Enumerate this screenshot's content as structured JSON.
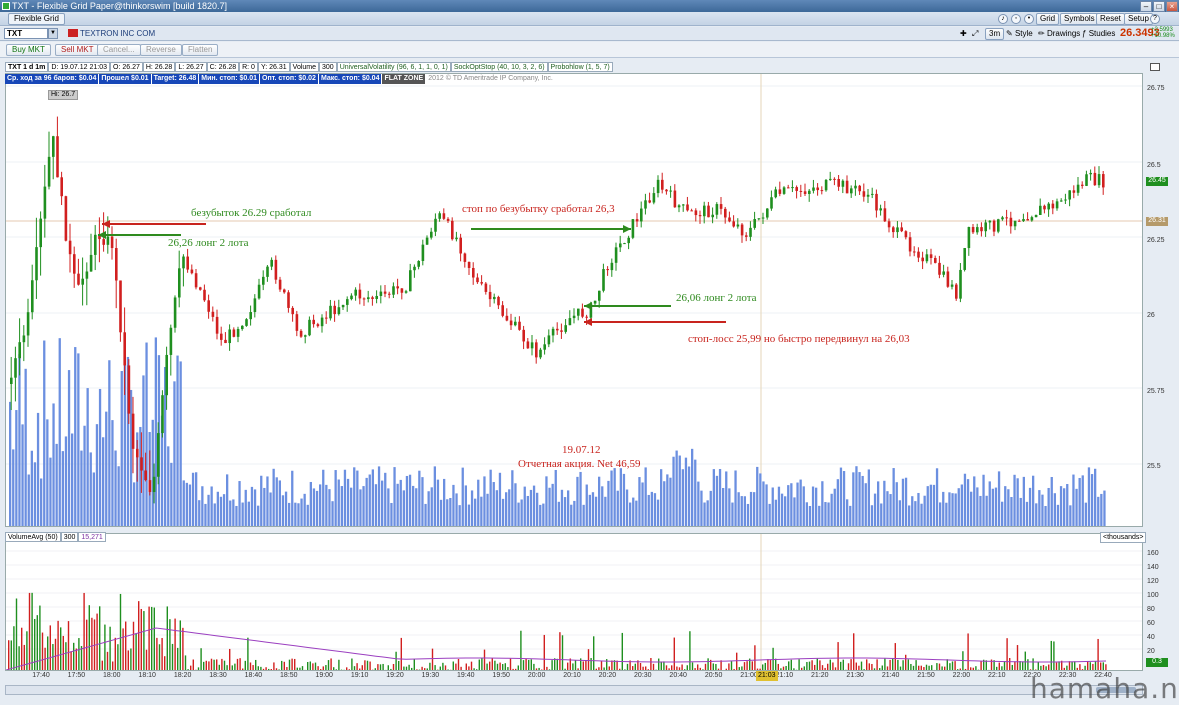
{
  "window": {
    "title": "TXT - Flexible Grid Paper@thinkorswim [build 1820.7]",
    "tab": "Flexible Grid"
  },
  "toolbar": {
    "grid": "Grid",
    "symbols": "Symbols",
    "reset": "Reset",
    "setup": "Setup"
  },
  "symbol_bar": {
    "symbol": "TXT",
    "description": "TEXTRON INC COM",
    "timeframe": "3m",
    "style": "Style",
    "drawings": "Drawings",
    "studies": "Studies",
    "last_price": "26.3493",
    "change_abs": "+2.5993",
    "change_pct": "+10.98%"
  },
  "trade_buttons": {
    "buy": "Buy MKT",
    "sell": "Sell MKT",
    "cancel": "Cancel...",
    "reverse": "Reverse",
    "flatten": "Flatten"
  },
  "info_bar": {
    "sym": "TXT 1 d 1m",
    "date": "D: 19.07.12 21:03",
    "open": "O: 26.27",
    "high": "H: 26.28",
    "low": "L: 26.27",
    "close": "C: 26.28",
    "r": "R: 0",
    "y": "Y: 26.31",
    "volume_label": "Volume",
    "volume_value": "300",
    "study1": "UniversalVolatility (96, 6, 1, 1, 0, 1)",
    "study2": "SockOptStop (40, 10, 3, 2, 6)",
    "study3": "Probohlow (1, 5, 7)"
  },
  "stat_bar": {
    "avg": "Ср. ход за 96 баров: $0.04",
    "passed": "Прошел $0.01",
    "target": "Target: 26.48",
    "minstop": "Мин. стоп: $0.01",
    "optstop": "Опт. стоп: $0.02",
    "maxstop": "Макс. стоп: $0.04",
    "flat": "FLAT ZONE",
    "copyright": "2012 © TD Ameritrade IP Company, Inc."
  },
  "hi_label": "Hi: 26.7",
  "annotations": {
    "a1": "безубыток 26.29 сработал",
    "a2": "26,26 лонг 2 лота",
    "a3": "стоп по безубытку сработал 26,3",
    "a4": "26,06 лонг 2 лота",
    "a5": "стоп-лосс 25,99 но быстро передвинул на 26,03",
    "a6_date": "19.07.12",
    "a6_text": "Отчетная акция. Net 46,59"
  },
  "price_axis": {
    "labels": [
      "26.75",
      "26.5",
      "26.25",
      "26",
      "25.75",
      "25.5"
    ],
    "last_tag": "26.45",
    "cursor_tag": "26.31"
  },
  "volume_panel": {
    "study": "VolumeAvg (50)",
    "value": "300",
    "avg": "15,271",
    "units": "<thousands>",
    "labels": [
      "160",
      "140",
      "120",
      "100",
      "80",
      "60",
      "40",
      "20"
    ],
    "last_tag": "0.3"
  },
  "time_axis": {
    "labels": [
      "17:40",
      "17:50",
      "18:00",
      "18:10",
      "18:20",
      "18:30",
      "18:40",
      "18:50",
      "19:00",
      "19:10",
      "19:20",
      "19:30",
      "19:40",
      "19:50",
      "20:00",
      "20:10",
      "20:20",
      "20:30",
      "20:40",
      "20:50",
      "21:00",
      "21:10",
      "21:20",
      "21:30",
      "21:40",
      "21:50",
      "22:00",
      "22:10",
      "22:20",
      "22:30",
      "22:40"
    ],
    "cursor": "21:03"
  },
  "watermark": "hamaha.net",
  "colors": {
    "up": "#1f8f1f",
    "down": "#d11f1f",
    "volume": "#6b8fe0",
    "avg_line": "#9b3fc0",
    "annotation_green": "#2e8a1e",
    "annotation_red": "#c8241e"
  }
}
